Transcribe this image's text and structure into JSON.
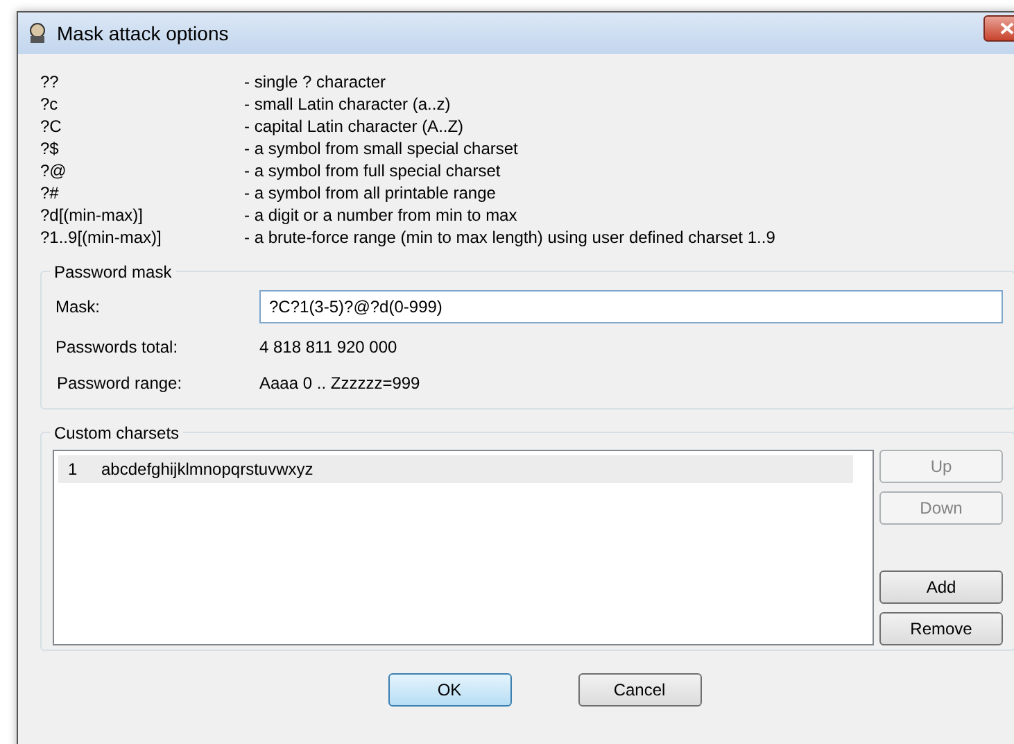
{
  "window": {
    "title": "Mask attack options"
  },
  "help": [
    {
      "code": "??",
      "description": "- single ? character"
    },
    {
      "code": "?c",
      "description": "- small Latin character (a..z)"
    },
    {
      "code": "?C",
      "description": "- capital Latin character (A..Z)"
    },
    {
      "code": "?$",
      "description": "- a symbol from small special charset"
    },
    {
      "code": "?@",
      "description": "- a symbol from full special charset"
    },
    {
      "code": "?#",
      "description": "- a symbol from all printable range"
    },
    {
      "code": "?d[(min-max)]",
      "description": "- a digit or a number from min to max"
    },
    {
      "code": "?1..9[(min-max)]",
      "description": "- a brute-force range (min to max length) using user defined charset 1..9"
    }
  ],
  "password_mask": {
    "title": "Password mask",
    "mask_label": "Mask:",
    "mask_value": "?C?1(3-5)?@?d(0-999)",
    "total_label": "Passwords total:",
    "total_value": "4 818 811 920 000",
    "range_label": "Password range:",
    "range_value": "Aaaa 0  ..  Zzzzzz=999"
  },
  "custom_charsets": {
    "title": "Custom charsets",
    "rows": [
      {
        "index": "1",
        "charset": "abcdefghijklmnopqrstuvwxyz",
        "selected": true
      }
    ],
    "buttons": [
      {
        "label": "Up",
        "disabled": true
      },
      {
        "label": "Down",
        "disabled": true
      },
      {
        "label": "Add",
        "disabled": false
      },
      {
        "label": "Remove",
        "disabled": false
      }
    ]
  },
  "buttons": [
    {
      "label": "OK",
      "default": true
    },
    {
      "label": "Cancel",
      "default": false
    }
  ]
}
